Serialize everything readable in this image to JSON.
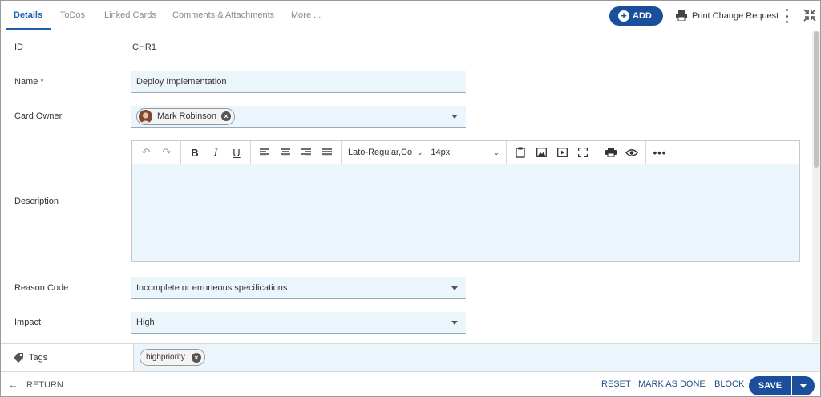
{
  "tabs": [
    {
      "label": "Details",
      "active": true
    },
    {
      "label": "ToDos"
    },
    {
      "label": "Linked Cards"
    },
    {
      "label": "Comments & Attachments"
    },
    {
      "label": "More ..."
    }
  ],
  "header": {
    "add_label": "ADD",
    "print_label": "Print Change Request",
    "accent_color": "#1b4f9c"
  },
  "fields": {
    "id": {
      "label": "ID",
      "value": "CHR1"
    },
    "name": {
      "label": "Name",
      "required_mark": "*",
      "value": "Deploy Implementation"
    },
    "card_owner": {
      "label": "Card Owner",
      "value": "Mark Robinson"
    },
    "description": {
      "label": "Description",
      "value": ""
    },
    "reason_code": {
      "label": "Reason Code",
      "value": "Incomplete or erroneous specifications"
    },
    "impact": {
      "label": "Impact",
      "value": "High"
    }
  },
  "editor": {
    "font": "Lato-Regular,Co",
    "size": "14px",
    "tools": [
      "undo-icon",
      "redo-icon",
      "bold-icon",
      "italic-icon",
      "underline-icon",
      "align-left-icon",
      "align-center-icon",
      "align-right-icon",
      "justify-icon",
      "paste-icon",
      "image-icon",
      "video-icon",
      "fullscreen-icon",
      "print-icon",
      "preview-icon",
      "more-icon"
    ]
  },
  "tags": {
    "label": "Tags",
    "items": [
      "highpriority"
    ]
  },
  "footer": {
    "return_label": "RETURN",
    "reset_label": "RESET",
    "mark_done_label": "MARK AS DONE",
    "block_label": "BLOCK",
    "save_label": "SAVE"
  }
}
